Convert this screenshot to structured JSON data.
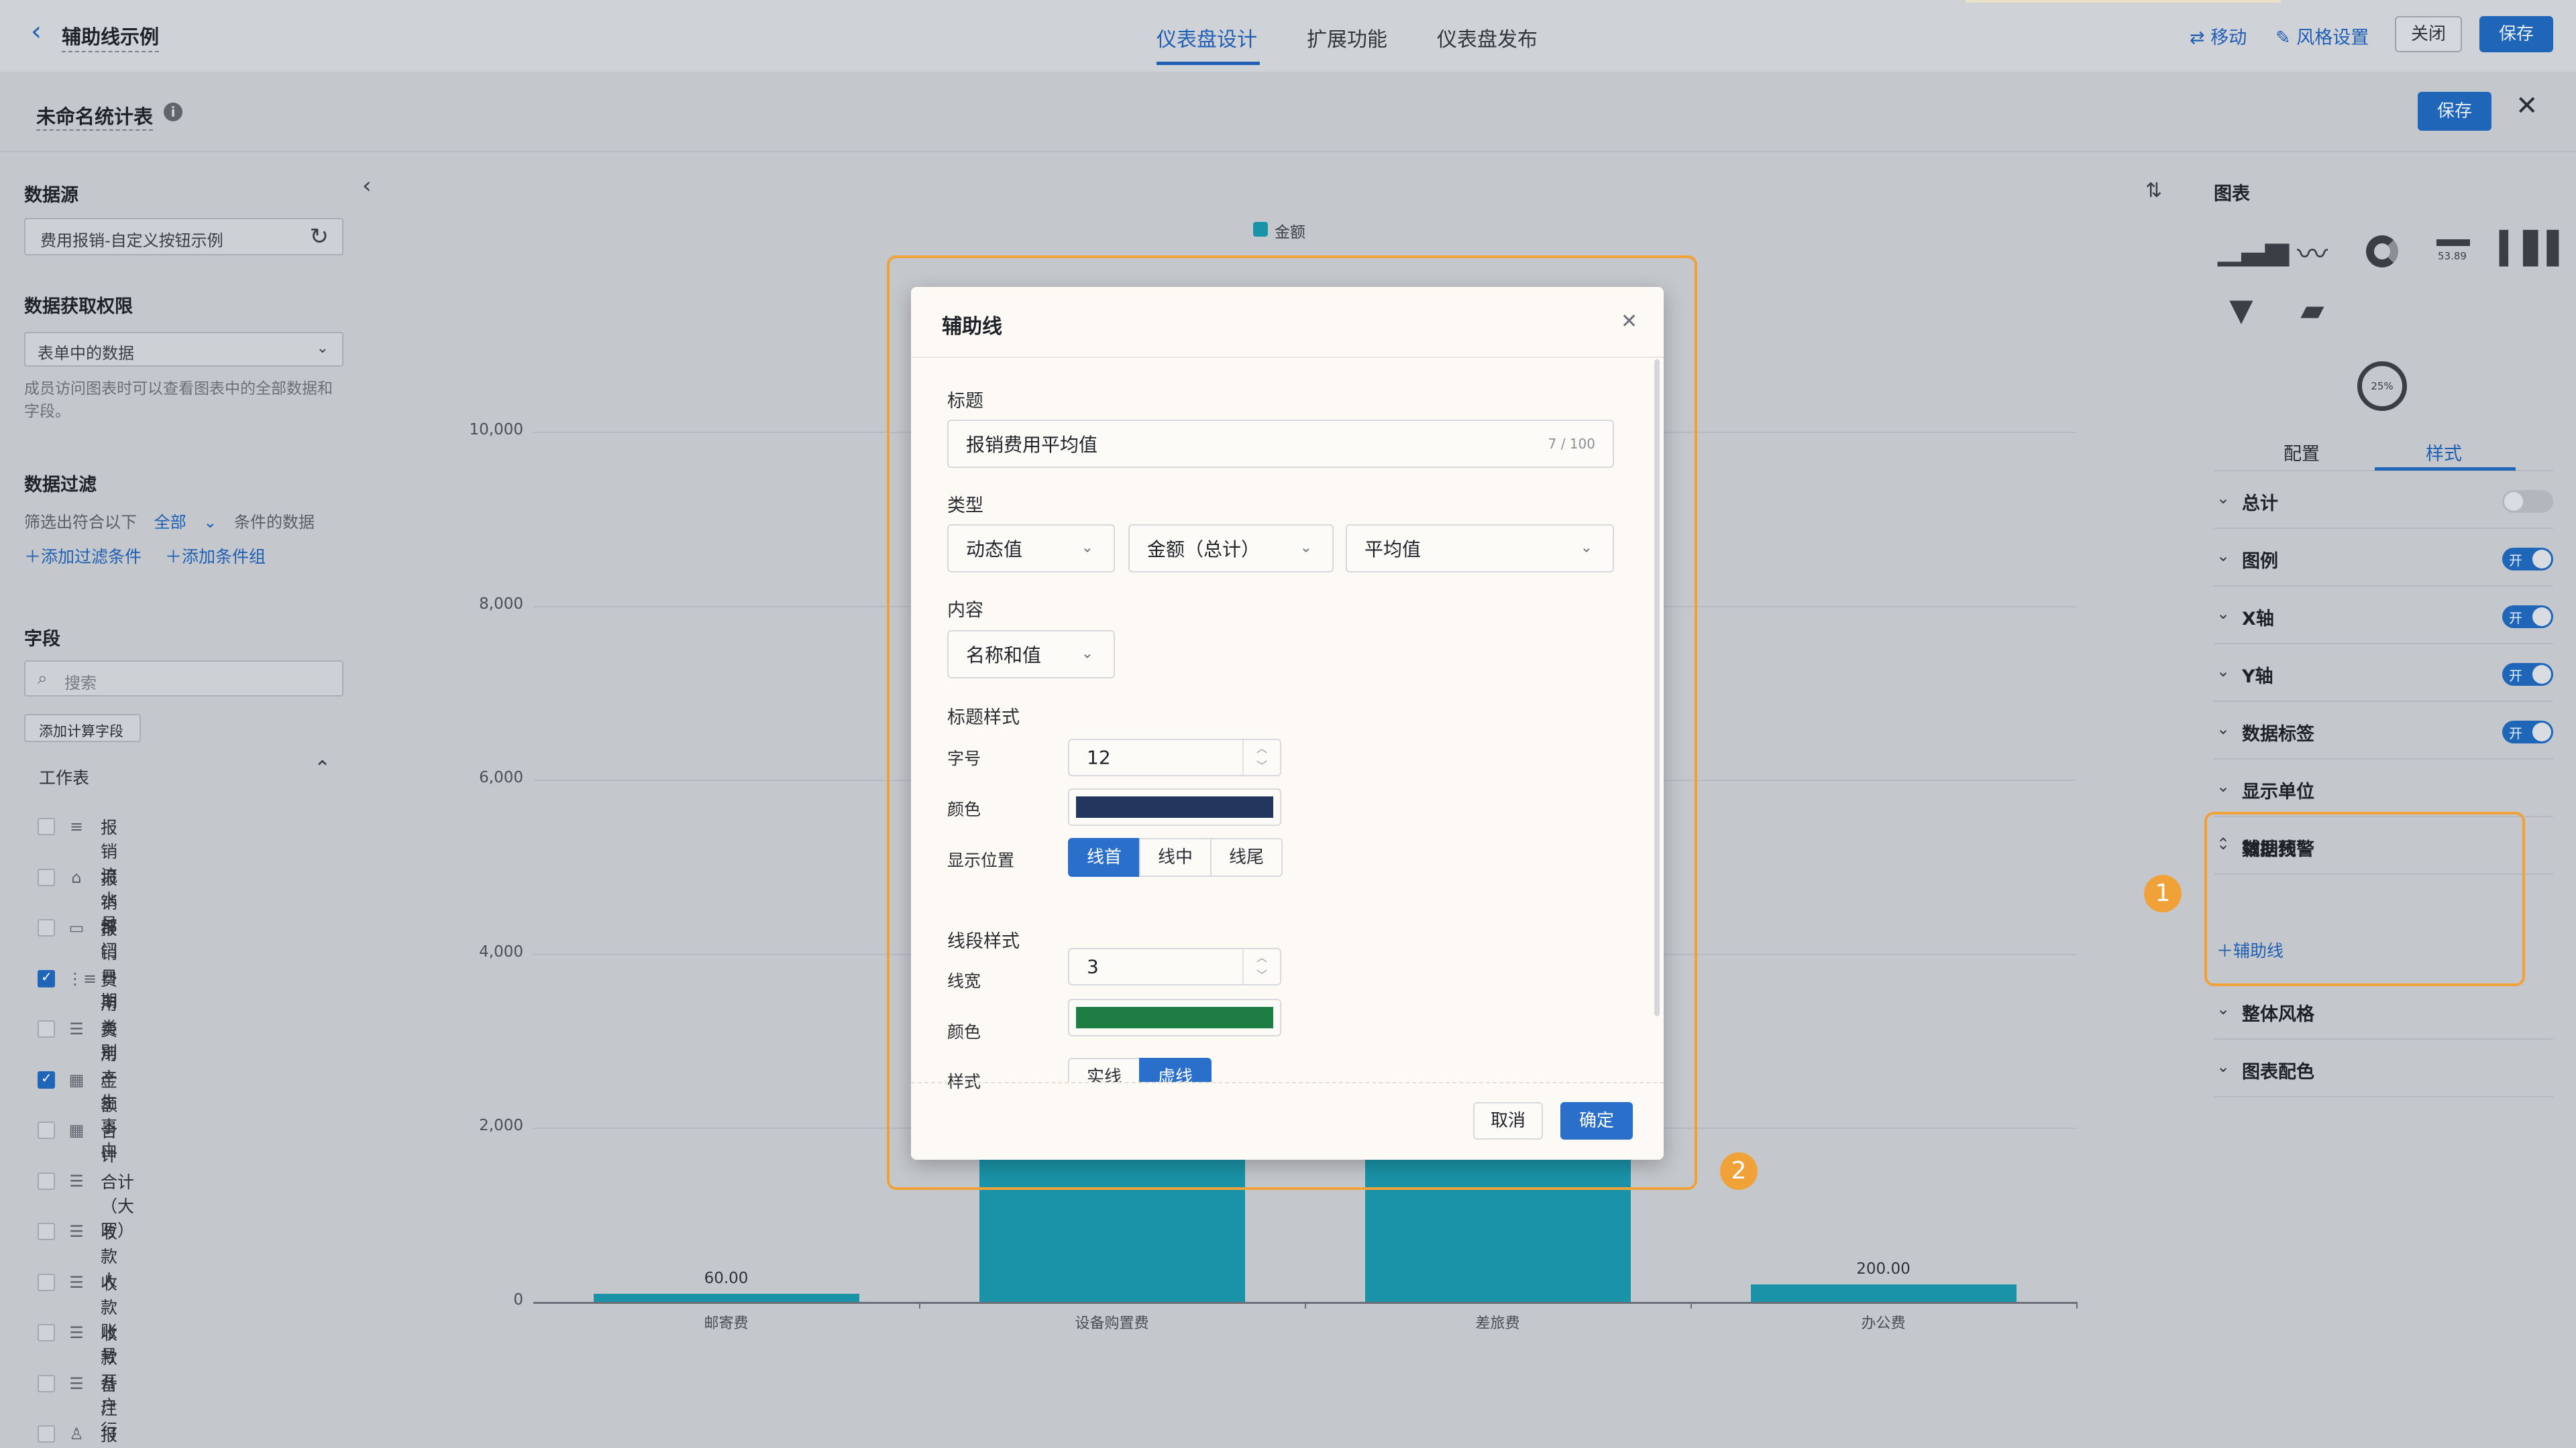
{
  "header": {
    "back_title": "辅助线示例",
    "tabs": [
      "仪表盘设计",
      "扩展功能",
      "仪表盘发布"
    ],
    "actions": {
      "move": "移动",
      "style": "风格设置",
      "close": "关闭",
      "save": "保存"
    }
  },
  "panel": {
    "title": "未命名统计表",
    "save": "保存"
  },
  "left": {
    "datasource_title": "数据源",
    "datasource_value": "费用报销-自定义按钮示例",
    "permission_title": "数据获取权限",
    "permission_value": "表单中的数据",
    "permission_note": "成员访问图表时可以查看图表中的全部数据和字段。",
    "filter_title": "数据过滤",
    "filter_prefix": "筛选出符合以下",
    "filter_scope": "全部",
    "filter_suffix": "条件的数据",
    "add_filter": "添加过滤条件",
    "add_group": "添加条件组",
    "fields_title": "字段",
    "search_placeholder": "搜索",
    "add_calc": "添加计算字段",
    "worksheet": "工作表",
    "fields": [
      {
        "label": "报销流水号",
        "icon": "≡",
        "checked": false
      },
      {
        "label": "报销部门",
        "icon": "⌂",
        "checked": false
      },
      {
        "label": "报销日期",
        "icon": "▭",
        "checked": false
      },
      {
        "label": "费用类别",
        "icon": "⋮≡",
        "checked": true
      },
      {
        "label": "费用产生事由",
        "icon": "☰",
        "checked": false
      },
      {
        "label": "金额",
        "icon": "▦",
        "checked": true
      },
      {
        "label": "合计",
        "icon": "▦",
        "checked": false
      },
      {
        "label": "合计（大写）",
        "icon": "☰",
        "checked": false
      },
      {
        "label": "收款人",
        "icon": "☰",
        "checked": false
      },
      {
        "label": "收款账号",
        "icon": "☰",
        "checked": false
      },
      {
        "label": "收款开户行",
        "icon": "☰",
        "checked": false
      },
      {
        "label": "备注",
        "icon": "☰",
        "checked": false
      },
      {
        "label": "报销人",
        "icon": "♙",
        "checked": false
      }
    ]
  },
  "chart_data": {
    "type": "bar",
    "legend": [
      "金额"
    ],
    "categories": [
      "邮寄费",
      "设备购置费",
      "差旅费",
      "办公费"
    ],
    "values": [
      60,
      null,
      null,
      200
    ],
    "data_labels": [
      "60.00",
      "",
      "",
      "200.00"
    ],
    "yticks": [
      "0",
      "2,000",
      "4,000",
      "6,000",
      "8,000",
      "10,000"
    ],
    "ylim": [
      0,
      10000
    ],
    "colors": {
      "bar": "#1a93a8"
    }
  },
  "right": {
    "chart_title": "图表",
    "tabs": [
      "配置",
      "样式"
    ],
    "kpi_number": "53.89",
    "gauge_pct": "25%",
    "rows": [
      {
        "label": "总计",
        "switch": "off"
      },
      {
        "label": "图例",
        "switch": "on"
      },
      {
        "label": "X轴",
        "switch": "on"
      },
      {
        "label": "Y轴",
        "switch": "on"
      },
      {
        "label": "数据标签",
        "switch": "on"
      },
      {
        "label": "显示单位",
        "switch": "none"
      },
      {
        "label": "数据预警",
        "switch": "none"
      }
    ],
    "switch_on": "开",
    "aux_title": "辅助线",
    "aux_add": "辅助线",
    "rows_after": [
      "整体风格",
      "图表配色"
    ]
  },
  "modal": {
    "title": "辅助线",
    "title_label": "标题",
    "title_value": "报销费用平均值",
    "title_count": "7 / 100",
    "type_label": "类型",
    "type_values": [
      "动态值",
      "金额（总计）",
      "平均值"
    ],
    "content_label": "内容",
    "content_value": "名称和值",
    "title_style_label": "标题样式",
    "font_size_label": "字号",
    "font_size_value": "12",
    "color_label": "颜色",
    "title_color": "#23375e",
    "position_label": "显示位置",
    "positions": [
      "线首",
      "线中",
      "线尾"
    ],
    "line_style_label": "线段样式",
    "line_width_label": "线宽",
    "line_width_value": "3",
    "line_color_label": "颜色",
    "line_color": "#1d7d43",
    "style_label": "样式",
    "styles": [
      "实线",
      "虚线"
    ],
    "cancel": "取消",
    "ok": "确定"
  },
  "badges": [
    "1",
    "2"
  ]
}
